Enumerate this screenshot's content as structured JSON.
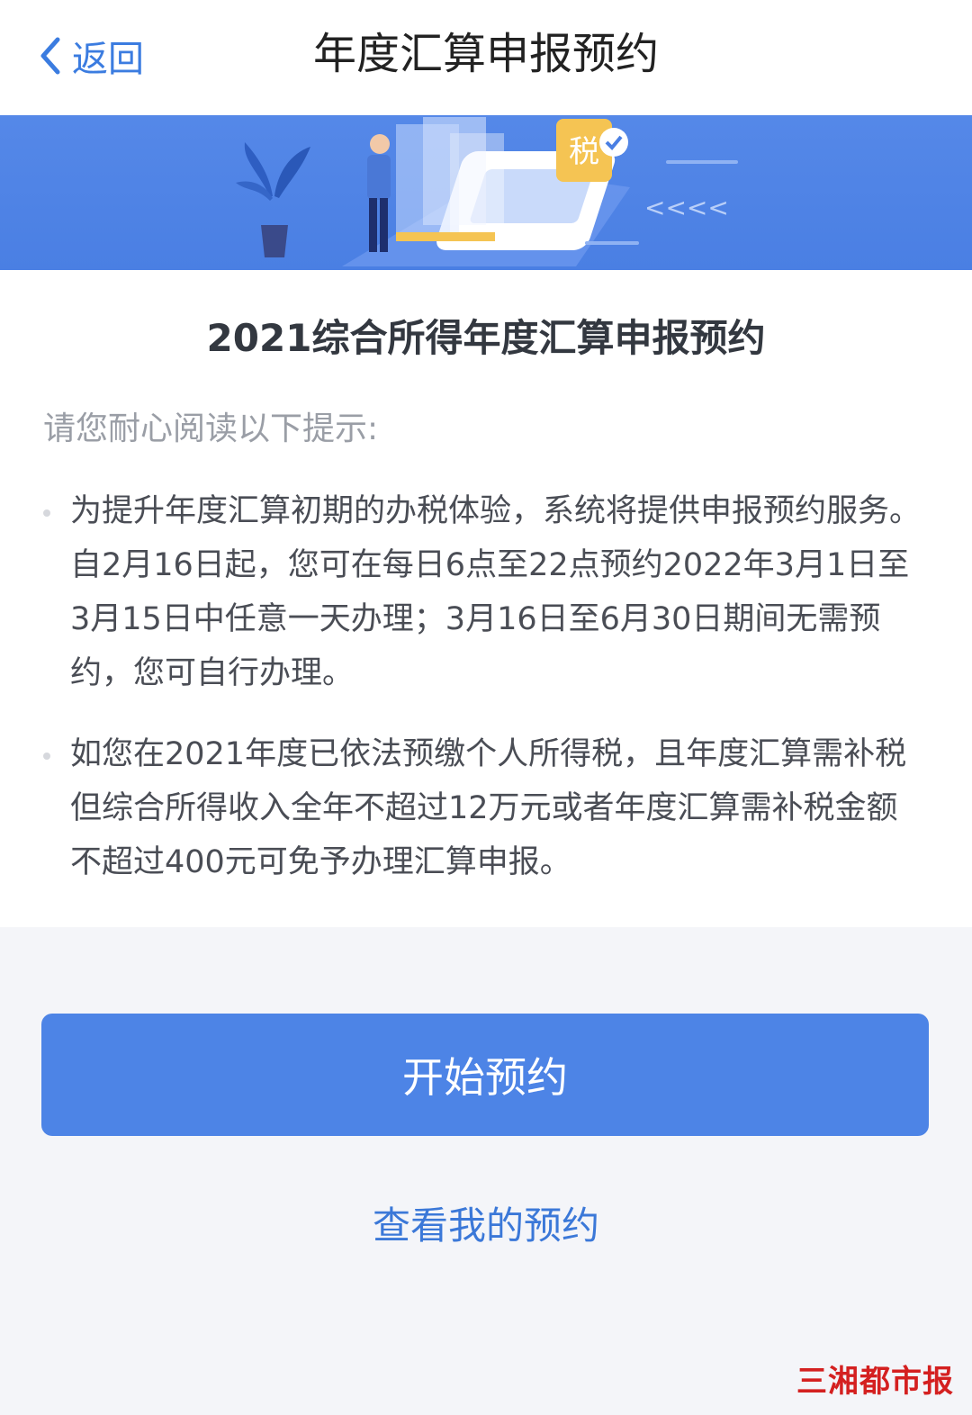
{
  "header": {
    "back_label": "返回",
    "title": "年度汇算申报预约"
  },
  "banner": {
    "tax_badge": "税",
    "arrows": "<<<<"
  },
  "content": {
    "title": "2021综合所得年度汇算申报预约",
    "hint": "请您耐心阅读以下提示:",
    "bullets": [
      "为提升年度汇算初期的办税体验，系统将提供申报预约服务。自2月16日起，您可在每日6点至22点预约2022年3月1日至3月15日中任意一天办理；3月16日至6月30日期间无需预约，您可自行办理。",
      "如您在2021年度已依法预缴个人所得税，且年度汇算需补税但综合所得收入全年不超过12万元或者年度汇算需补税金额不超过400元可免予办理汇算申报。"
    ]
  },
  "actions": {
    "start_label": "开始预约",
    "view_label": "查看我的预约"
  },
  "watermark": "三湘都市报",
  "colors": {
    "accent": "#4d84e6",
    "link": "#3b78d8",
    "banner": "#4a7fe3"
  }
}
